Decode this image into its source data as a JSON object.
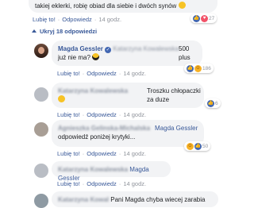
{
  "top_comment": {
    "text": "takiej eklerki, robię obiad dla siebie i dwóch synów",
    "like": "Lubię to!",
    "reply": "Odpowiedz",
    "time": "14 godz.",
    "reaction_count": "27"
  },
  "hide_replies": "Ukryj 18 odpowiedzi",
  "replies": [
    {
      "author": "Magda Gessler",
      "mention": "Katarzyna Kowalewska",
      "text_1": "500 plus",
      "text_2": "już nie ma?",
      "like": "Lubię to!",
      "reply": "Odpowiedz",
      "time": "14 godz.",
      "reaction_count": "186"
    },
    {
      "author": "Katarzyna Kowalewska",
      "text": "Troszku chłopaczki za duze",
      "like": "Lubię to!",
      "reply": "Odpowiedz",
      "time": "14 godz.",
      "reaction_count": "6"
    },
    {
      "author": "Agnieszka Gelinska-Michalska",
      "mention": "Magda Gessler",
      "text": "odpowiedź poniżej krytyki...",
      "like": "Lubię to!",
      "reply": "Odpowiedz",
      "time": "14 godz.",
      "reaction_count": "50"
    },
    {
      "author": "Katarzyna Kowalewska",
      "mention": "Magda Gessler",
      "like": "Lubię to!",
      "reply": "Odpowiedz",
      "time": "14 godz."
    },
    {
      "author": "Katarzyna Kowal",
      "text": "Pani Magda chyba wiecej zarabia"
    }
  ],
  "colors": {
    "link": "#385898",
    "bubble": "#f2f3f5",
    "meta": "#90949c"
  }
}
